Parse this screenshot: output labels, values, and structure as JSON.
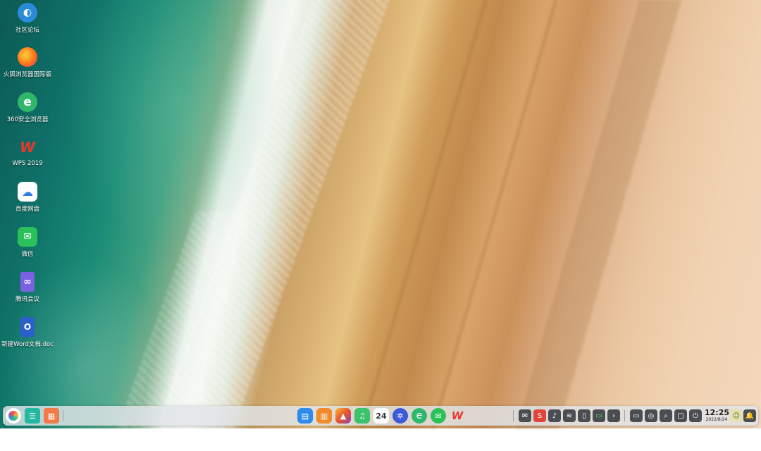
{
  "desktop": {
    "icons": [
      {
        "label": "社区论坛",
        "icon": "community-forum-icon",
        "color": "#2a8bd8"
      },
      {
        "label": "火狐浏览器国际版",
        "icon": "firefox-icon",
        "color": "#ff6a1a"
      },
      {
        "label": "360安全浏览器",
        "icon": "360-browser-icon",
        "color": "#2fb86b"
      },
      {
        "label": "WPS 2019",
        "icon": "wps-icon",
        "color": "#e8382f"
      },
      {
        "label": "百度网盘",
        "icon": "baidu-netdisk-icon",
        "color": "#2d7be6"
      },
      {
        "label": "微信",
        "icon": "wechat-icon",
        "color": "#2bc15a"
      },
      {
        "label": "腾讯会议",
        "icon": "tencent-meeting-icon",
        "color": "#7a61e0"
      },
      {
        "label": "新建Word文档.doc",
        "icon": "word-document-icon",
        "color": "#2b5fc9"
      }
    ]
  },
  "dock": {
    "left": [
      {
        "name": "launcher-icon",
        "color": "#ffffff"
      },
      {
        "name": "multitask-view-icon",
        "color": "#25b8a0"
      },
      {
        "name": "workspace-icon",
        "color": "#f07a4a"
      }
    ],
    "center": [
      {
        "name": "app-store-icon",
        "color": "#2f8bea"
      },
      {
        "name": "reader-icon",
        "color": "#f08a2a"
      },
      {
        "name": "image-viewer-icon",
        "color": "#e8532e"
      },
      {
        "name": "music-icon",
        "color": "#3cc26b"
      },
      {
        "name": "calendar-icon",
        "color": "#ffffff",
        "text": "24"
      },
      {
        "name": "settings-icon",
        "color": "#3d5bd9"
      },
      {
        "name": "360-browser-dock-icon",
        "color": "#2fb86b"
      },
      {
        "name": "wechat-dock-icon",
        "color": "#2bc15a"
      },
      {
        "name": "wps-dock-icon",
        "color": "#e8382f"
      }
    ],
    "tray": [
      {
        "name": "wechat-tray-icon",
        "glyph": "✉"
      },
      {
        "name": "sogou-input-icon",
        "glyph": "S"
      },
      {
        "name": "volume-icon",
        "glyph": "♪"
      },
      {
        "name": "wifi-icon",
        "glyph": "≋"
      },
      {
        "name": "mouse-icon",
        "glyph": "▯"
      },
      {
        "name": "battery-icon",
        "glyph": "▭"
      },
      {
        "name": "tray-expand-icon",
        "glyph": "›"
      }
    ],
    "system": [
      {
        "name": "screen-projection-icon",
        "glyph": "▭"
      },
      {
        "name": "screenshot-icon",
        "glyph": "◎"
      },
      {
        "name": "search-icon",
        "glyph": "⌕"
      },
      {
        "name": "show-desktop-icon",
        "glyph": "▢"
      },
      {
        "name": "power-icon",
        "glyph": "⏻"
      }
    ],
    "clock": {
      "time": "12:25",
      "date": "2022/8/24"
    }
  }
}
